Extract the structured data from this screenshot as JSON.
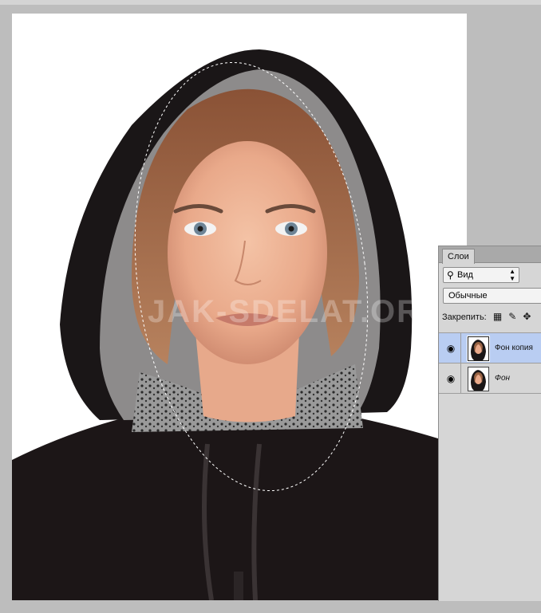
{
  "watermark": "JAK-SDELAT.ORG",
  "layers_panel": {
    "tab_label": "Слои",
    "filter": {
      "label": "Вид",
      "icon": "search-icon"
    },
    "blend_mode": "Обычные",
    "lock_label": "Закрепить:",
    "lock_icons": [
      "lock-transparent-pixels-icon",
      "lock-image-pixels-icon",
      "lock-position-icon"
    ],
    "layers": [
      {
        "name": "Фон копия",
        "visible": true,
        "selected": true
      },
      {
        "name": "Фон",
        "visible": true,
        "selected": false,
        "italic": true
      }
    ]
  },
  "colors": {
    "selected_layer": "#b9cdf2",
    "panel_bg": "#d6d6d6",
    "app_bg": "#bdbdbd"
  }
}
